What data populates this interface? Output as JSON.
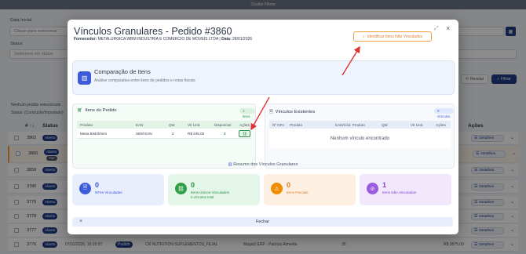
{
  "background": {
    "topbar": "Ocultar Filtros",
    "date_label": "Data Inicial",
    "date_placeholder": "Clique para selecionar",
    "status_label": "Status",
    "status_placeholder": "Selecione um status",
    "reset_button": "Resetar",
    "filter_button": "Filtrar",
    "selected_text": "Nenhum pedido selecionado",
    "status_line": "Status: (Concluído/Importado)",
    "col_num": "# ↑↓",
    "col_status": "Status",
    "col_actions": "Ações",
    "rows": [
      {
        "num": "3862",
        "status": "Aberto",
        "extra": "",
        "cells": []
      },
      {
        "num": "3860",
        "status": "Aberto",
        "extra": "TNF",
        "cells": []
      },
      {
        "num": "3859",
        "status": "Aberto",
        "extra": "",
        "cells": []
      },
      {
        "num": "3780",
        "status": "Aberto",
        "extra": "",
        "cells": []
      },
      {
        "num": "3779",
        "status": "Aberto",
        "extra": "",
        "cells": []
      },
      {
        "num": "3778",
        "status": "Aberto",
        "extra": "",
        "cells": []
      },
      {
        "num": "3777",
        "status": "Aberto",
        "extra": "",
        "cells": []
      },
      {
        "num": "3776",
        "status": "Aberto",
        "extra": "",
        "cells": [
          "07/01/2026, 16:16:57",
          "Pedido",
          "CR NUTRITION SUPLEMENTOS_FILIAL",
          "Magis5 ERP - Patrícia Almeida",
          "35",
          "R$ 3875,00"
        ]
      }
    ],
    "details_label": "Detalhes"
  },
  "modal": {
    "title": "Vínculos Granulares - Pedido #3860",
    "supplier_label": "Fornecedor:",
    "supplier_value": "METALURGICA WBM INDUSTRIA E COMERCIO DE MOVEIS LTDA",
    "date_label": "Data:",
    "date_value": "28/01/2026",
    "identify_button": "Identificar Itens Não Vinculados",
    "comparison": {
      "title": "Comparação de Itens",
      "description": "Análise comparativa entre itens de pedidos e notas fiscais"
    },
    "order_items": {
      "title": "Itens do Pedido",
      "badge": "1 itens",
      "headers": [
        "Produto",
        "EAN",
        "Qtd",
        "Vlr Unit.",
        "Disponível",
        "Ações"
      ],
      "rows": [
        {
          "produto": "Mesa Bistrô/mini",
          "ean": "SEM EAN",
          "qtd": "2",
          "vlr": "R$ 245,00",
          "disp": "2"
        }
      ]
    },
    "links": {
      "title": "Vínculos Existentes",
      "badge": "0 vínculos",
      "headers": [
        "Nº NFe",
        "Produto",
        "EAN/Cód. Produto",
        "Qtd",
        "Vlr Unit.",
        "Ações"
      ],
      "empty": "Nenhum vínculo encontrado"
    },
    "summary_title": "Resumo dos Vínculos Granulares",
    "cards": [
      {
        "value": "0",
        "label": "NFes Vinculadas",
        "extra": ""
      },
      {
        "value": "0",
        "label": "Itens Únicos Vinculados",
        "extra": "0 vínculos total"
      },
      {
        "value": "0",
        "label": "Itens Parciais",
        "extra": ""
      },
      {
        "value": "1",
        "label": "Itens Não Vinculados",
        "extra": ""
      }
    ],
    "close_button": "Fechar"
  },
  "colors": {
    "primary": "#1f3c88",
    "accent_orange": "#f0a03c",
    "arrow_red": "#e03131",
    "green": "#2f8f46",
    "purple": "#8a44d4"
  }
}
